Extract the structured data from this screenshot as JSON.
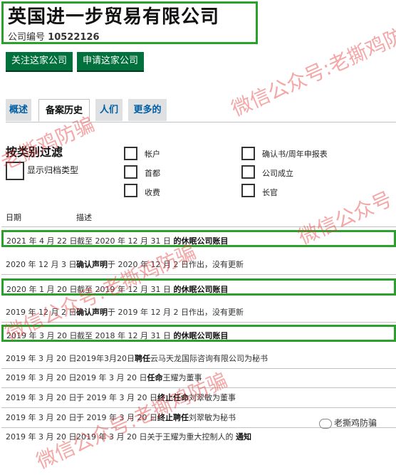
{
  "company": {
    "name": "英国进一步贸易有限公司",
    "number_label": "公司编号",
    "number": "10522126"
  },
  "actions": {
    "follow": "关注这家公司",
    "apply": "申请这家公司"
  },
  "tabs": [
    {
      "label": "概述"
    },
    {
      "label": "备案历史"
    },
    {
      "label": "人们"
    },
    {
      "label": "更多的"
    }
  ],
  "filter": {
    "title": "按类别过滤",
    "show_types": "显示归档类型",
    "options": [
      "帐户",
      "确认书/周年申报表",
      "首都",
      "公司成立",
      "收费",
      "长官"
    ]
  },
  "table": {
    "headers": {
      "date": "日期",
      "desc": "描述"
    },
    "rows": [
      {
        "date": "2021 年 4 月 22 日",
        "prefix": "截至 2020 年 12 月 31 日 ",
        "bold": "的休眠公司账目",
        "suffix": ""
      },
      {
        "date": "2020 年 12 月 3 日",
        "prefix": "",
        "bold": "确认声明",
        "suffix": "于 2020 年 12 月 2 日作出，没有更新"
      },
      {
        "date": "2020 年 1 月 20 日",
        "prefix": "截至 2019 年 12 月 31 日 ",
        "bold": "的休眠公司账目",
        "suffix": ""
      },
      {
        "date": "2019 年 12 月 2 日",
        "prefix": "",
        "bold": "确认声明",
        "suffix": "于 2019 年 12 月 2 日作出，没有更新"
      },
      {
        "date": "2019 年 3 月 20 日",
        "prefix": "截至 2018 年 12 月 31 日 ",
        "bold": "的休眠公司账目",
        "suffix": ""
      },
      {
        "date": "2019 年 3 月 20 日",
        "prefix": "2019年3月20日",
        "bold": "聘任",
        "suffix": "云马天龙国际咨询有限公司为秘书"
      },
      {
        "date": "2019 年 3 月 20 日",
        "prefix": "2019 年 3 月 20 日",
        "bold": "任命",
        "suffix": "王耀为董事"
      },
      {
        "date": "2019 年 3 月 20 日",
        "prefix": "于 2019 年 3 月 20 日",
        "bold": "终止任命",
        "suffix": "刘翠敏为董事"
      },
      {
        "date": "2019 年 3 月 20 日",
        "prefix": "于 2019 年 3 月 20 日",
        "bold": "终止聘任",
        "suffix": "刘翠敏为秘书"
      },
      {
        "date": "2019 年 3 月 20 日",
        "prefix": "2019 年 3 月 20 日关于王耀为重大控制人的 ",
        "bold": "通知",
        "suffix": ""
      }
    ]
  },
  "watermarks": {
    "a": "微信公众号:老撕鸡防骗",
    "b": "老撕鸡防骗",
    "c": "微信公众号",
    "corner": "老撕鸡防骗"
  },
  "colors": {
    "button": "#00703c",
    "highlight": "#2ca02c",
    "watermark": "#e63c3c"
  }
}
